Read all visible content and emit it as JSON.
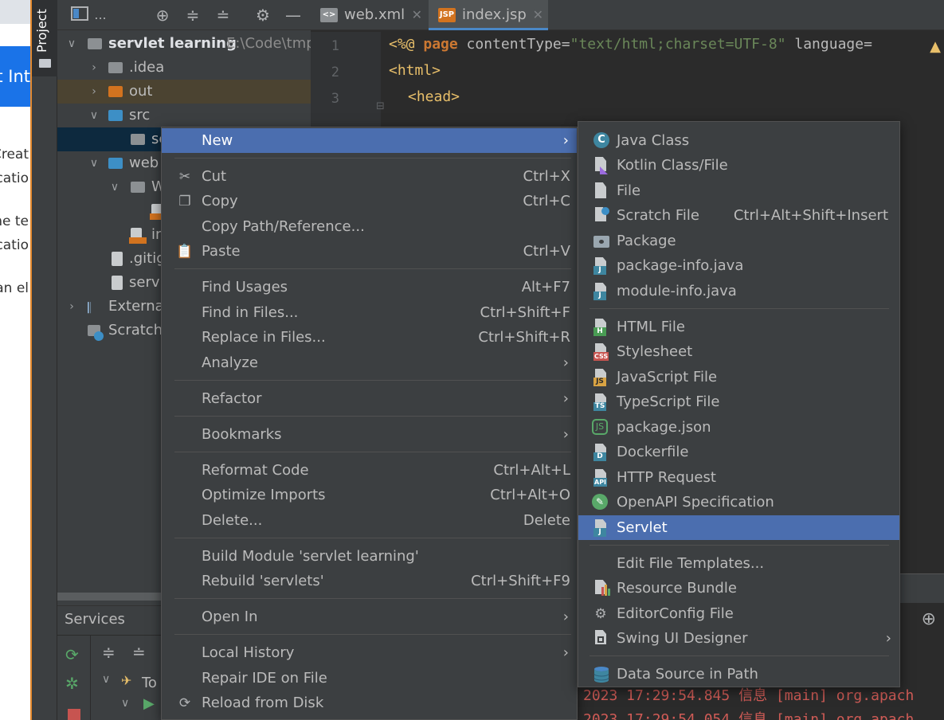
{
  "project_tool": {
    "label": "Project"
  },
  "background_browser": {
    "banner_text": "t Int",
    "lines": [
      "Creat",
      "catio",
      "ne te",
      "catio",
      "an el"
    ]
  },
  "project_panel": {
    "toolbar_title": "...",
    "tree": [
      {
        "label": "servlet learning",
        "path": "E:\\Code\\tmp"
      },
      {
        "label": ".idea"
      },
      {
        "label": "out"
      },
      {
        "label": "src"
      },
      {
        "label": "se"
      },
      {
        "label": "web"
      },
      {
        "label": "W"
      },
      {
        "label": "in"
      },
      {
        "label": ".gitig"
      },
      {
        "label": "servl"
      },
      {
        "label": "Externa"
      },
      {
        "label": "Scratche"
      }
    ]
  },
  "services": {
    "title": "Services",
    "tree_item": "To"
  },
  "editor": {
    "tabs": [
      {
        "label": "web.xml",
        "icon": "xml-file-icon"
      },
      {
        "label": "index.jsp",
        "icon": "jsp-file-icon",
        "active": true
      }
    ],
    "line_numbers": [
      "1",
      "2",
      "3"
    ],
    "code": {
      "line1_open": "<%@ ",
      "line1_kw": "page",
      "line1_attr": " contentType=",
      "line1_str": "\"text/html;charset=UTF-8\"",
      "line1_rest": " language=",
      "line2": "<html>",
      "line3": "<head>"
    },
    "console_lines": [
      "2023 17:29:54.845 信息 [main] org.apach",
      "2023 17:29:54.054 信息 [main] org.apach"
    ]
  },
  "context_menu": {
    "items": [
      {
        "label": "New",
        "submenu": true,
        "highlighted": true
      },
      {
        "label": "Cut",
        "shortcut": "Ctrl+X",
        "icon": "scissors-icon"
      },
      {
        "label": "Copy",
        "shortcut": "Ctrl+C",
        "icon": "copy-icon"
      },
      {
        "label": "Copy Path/Reference..."
      },
      {
        "label": "Paste",
        "shortcut": "Ctrl+V",
        "icon": "clipboard-icon"
      },
      {
        "label": "Find Usages",
        "shortcut": "Alt+F7"
      },
      {
        "label": "Find in Files...",
        "shortcut": "Ctrl+Shift+F"
      },
      {
        "label": "Replace in Files...",
        "shortcut": "Ctrl+Shift+R"
      },
      {
        "label": "Analyze",
        "submenu": true
      },
      {
        "label": "Refactor",
        "submenu": true
      },
      {
        "label": "Bookmarks",
        "submenu": true
      },
      {
        "label": "Reformat Code",
        "shortcut": "Ctrl+Alt+L"
      },
      {
        "label": "Optimize Imports",
        "shortcut": "Ctrl+Alt+O"
      },
      {
        "label": "Delete...",
        "shortcut": "Delete"
      },
      {
        "label": "Build Module 'servlet learning'"
      },
      {
        "label": "Rebuild 'servlets'",
        "shortcut": "Ctrl+Shift+F9"
      },
      {
        "label": "Open In",
        "submenu": true
      },
      {
        "label": "Local History",
        "submenu": true
      },
      {
        "label": "Repair IDE on File"
      },
      {
        "label": "Reload from Disk",
        "icon": "reload-icon"
      }
    ]
  },
  "new_submenu": {
    "items": [
      {
        "label": "Java Class",
        "icon": "java-class-icon"
      },
      {
        "label": "Kotlin Class/File",
        "icon": "kotlin-file-icon"
      },
      {
        "label": "File",
        "icon": "file-icon"
      },
      {
        "label": "Scratch File",
        "shortcut": "Ctrl+Alt+Shift+Insert",
        "icon": "scratch-file-icon"
      },
      {
        "label": "Package",
        "icon": "package-icon"
      },
      {
        "label": "package-info.java",
        "icon": "java-file-icon"
      },
      {
        "label": "module-info.java",
        "icon": "java-file-icon"
      },
      {
        "label": "HTML File",
        "icon": "html-file-icon",
        "badge": "H"
      },
      {
        "label": "Stylesheet",
        "icon": "css-file-icon",
        "badge": "CSS"
      },
      {
        "label": "JavaScript File",
        "icon": "js-file-icon",
        "badge": "JS"
      },
      {
        "label": "TypeScript File",
        "icon": "ts-file-icon",
        "badge": "TS"
      },
      {
        "label": "package.json",
        "icon": "nodejs-icon"
      },
      {
        "label": "Dockerfile",
        "icon": "docker-file-icon",
        "badge": "D"
      },
      {
        "label": "HTTP Request",
        "icon": "http-request-icon",
        "badge": "API"
      },
      {
        "label": "OpenAPI Specification",
        "icon": "openapi-icon"
      },
      {
        "label": "Servlet",
        "icon": "servlet-icon",
        "highlighted": true,
        "badge": "J"
      },
      {
        "label": "Edit File Templates..."
      },
      {
        "label": "Resource Bundle",
        "icon": "resource-bundle-icon"
      },
      {
        "label": "EditorConfig File",
        "icon": "gear-icon"
      },
      {
        "label": "Swing UI Designer",
        "icon": "swing-designer-icon",
        "submenu": true
      },
      {
        "label": "Data Source in Path",
        "icon": "database-icon"
      }
    ]
  },
  "colors": {
    "menu_bg": "#3c3f41",
    "highlight": "#4b6eaf",
    "editor_bg": "#2b2b2b",
    "accent_tab": "#4a88c7"
  }
}
